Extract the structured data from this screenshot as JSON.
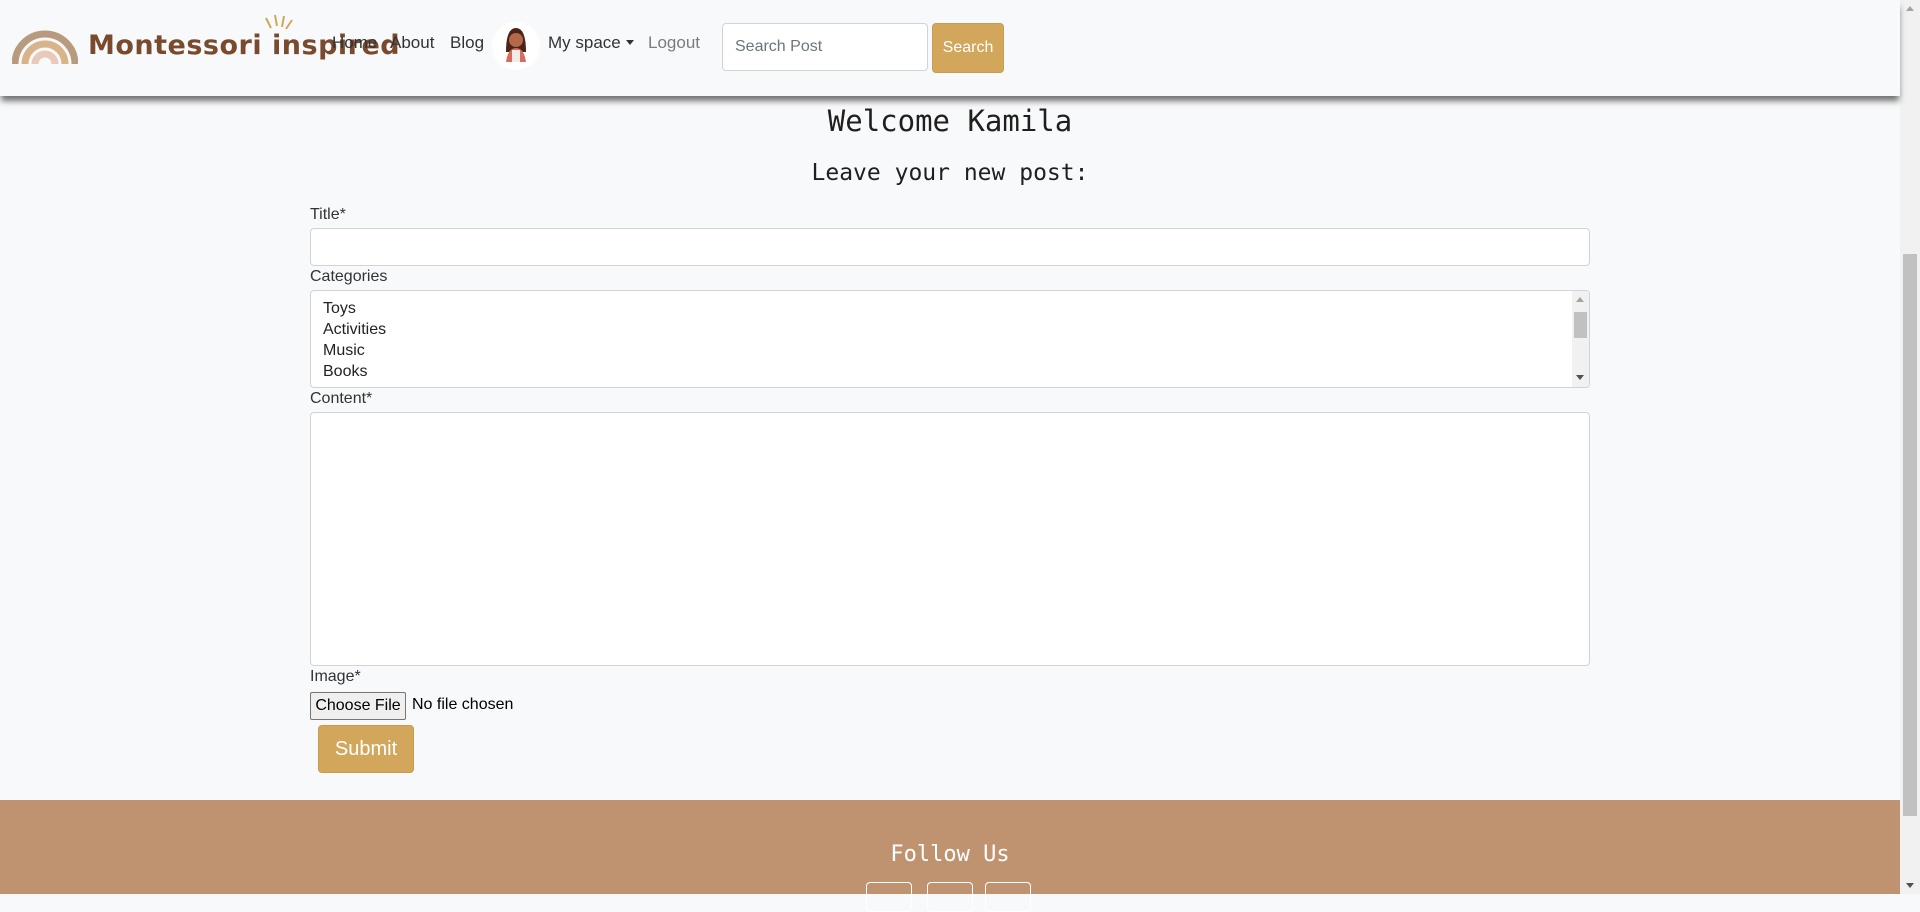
{
  "navbar": {
    "brand": "Montessori inspired",
    "links": {
      "home": "Home",
      "about": "About",
      "blog": "Blog",
      "my_space": "My space",
      "logout": "Logout"
    },
    "search": {
      "placeholder": "Search Post",
      "button": "Search"
    }
  },
  "main": {
    "welcome": "Welcome Kamila",
    "subtitle": "Leave your new post:",
    "form": {
      "title_label": "Title*",
      "title_value": "",
      "categories_label": "Categories",
      "categories": [
        "Toys",
        "Activities",
        "Music",
        "Books"
      ],
      "content_label": "Content*",
      "content_value": "",
      "image_label": "Image*",
      "file_button": "Choose File",
      "file_status": "No file chosen",
      "submit": "Submit"
    }
  },
  "footer": {
    "heading": "Follow Us",
    "social_icons": [
      "social-icon-1",
      "social-icon-2",
      "social-icon-3"
    ]
  },
  "colors": {
    "accent_gold": "#d2a75c",
    "brand_brown": "#7a4a2e",
    "footer_bg": "#c09370",
    "page_bg": "#f8f9fa"
  }
}
